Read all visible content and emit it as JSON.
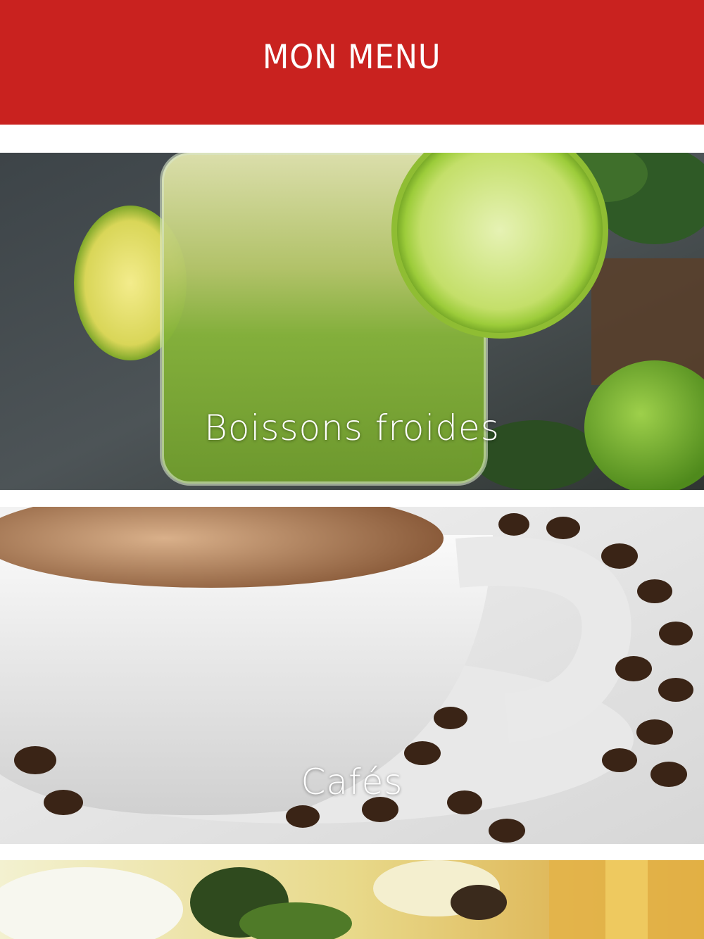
{
  "header": {
    "title": "MON MENU",
    "background": "#c9221f"
  },
  "categories": [
    {
      "label": "Boissons froides",
      "image": "green-juice-with-lime-photo"
    },
    {
      "label": "Cafés",
      "image": "coffee-cup-with-beans-photo"
    },
    {
      "label": "",
      "image": "food-dish-photo"
    }
  ]
}
